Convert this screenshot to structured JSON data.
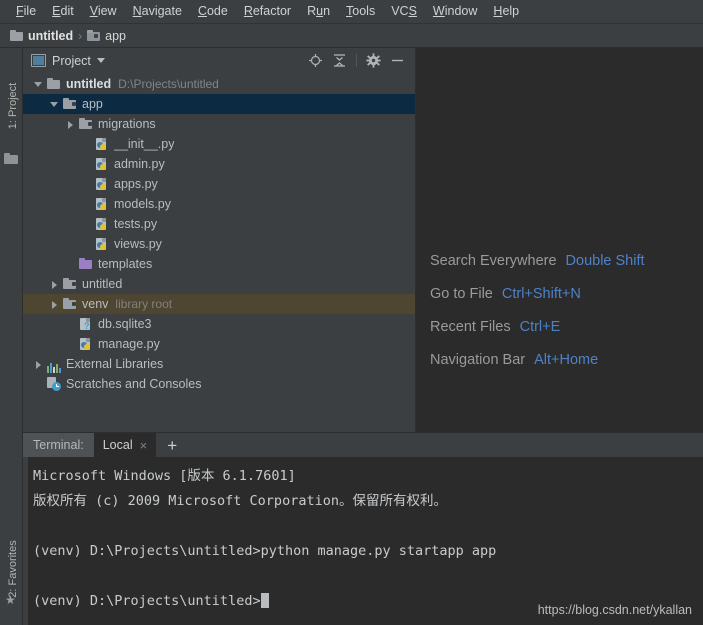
{
  "menubar": {
    "items": [
      {
        "label": "File",
        "accel": "F"
      },
      {
        "label": "Edit",
        "accel": "E"
      },
      {
        "label": "View",
        "accel": "V"
      },
      {
        "label": "Navigate",
        "accel": "N"
      },
      {
        "label": "Code",
        "accel": "C"
      },
      {
        "label": "Refactor",
        "accel": "R"
      },
      {
        "label": "Run",
        "accel": "u"
      },
      {
        "label": "Tools",
        "accel": "T"
      },
      {
        "label": "VCS",
        "accel": "S"
      },
      {
        "label": "Window",
        "accel": "W"
      },
      {
        "label": "Help",
        "accel": "H"
      }
    ]
  },
  "navbar": {
    "crumb1": "untitled",
    "separator": "›",
    "crumb2": "app"
  },
  "left_strip": {
    "project_tab": "1: Project",
    "favorites_tab": "2: Favorites"
  },
  "project_panel": {
    "title": "Project",
    "tools": {
      "locate": "locate-icon",
      "collapse": "collapse-all-icon",
      "settings": "gear-icon",
      "hide": "minimize-icon"
    },
    "tree": [
      {
        "label": "untitled",
        "hint": "D:\\Projects\\untitled",
        "icon": "folder",
        "arrow": "down",
        "indent": 0,
        "bold": true,
        "state": "normal"
      },
      {
        "label": "app",
        "hint": "",
        "icon": "folder-module",
        "arrow": "down",
        "indent": 1,
        "bold": false,
        "state": "selected"
      },
      {
        "label": "migrations",
        "hint": "",
        "icon": "folder-module",
        "arrow": "right",
        "indent": 2,
        "bold": false,
        "state": "normal"
      },
      {
        "label": "__init__.py",
        "hint": "",
        "icon": "python",
        "arrow": "none",
        "indent": 3,
        "bold": false,
        "state": "normal"
      },
      {
        "label": "admin.py",
        "hint": "",
        "icon": "python",
        "arrow": "none",
        "indent": 3,
        "bold": false,
        "state": "normal"
      },
      {
        "label": "apps.py",
        "hint": "",
        "icon": "python",
        "arrow": "none",
        "indent": 3,
        "bold": false,
        "state": "normal"
      },
      {
        "label": "models.py",
        "hint": "",
        "icon": "python",
        "arrow": "none",
        "indent": 3,
        "bold": false,
        "state": "normal"
      },
      {
        "label": "tests.py",
        "hint": "",
        "icon": "python",
        "arrow": "none",
        "indent": 3,
        "bold": false,
        "state": "normal"
      },
      {
        "label": "views.py",
        "hint": "",
        "icon": "python",
        "arrow": "none",
        "indent": 3,
        "bold": false,
        "state": "normal"
      },
      {
        "label": "templates",
        "hint": "",
        "icon": "folder-template",
        "arrow": "none",
        "indent": 2,
        "bold": false,
        "state": "normal"
      },
      {
        "label": "untitled",
        "hint": "",
        "icon": "folder-module",
        "arrow": "right",
        "indent": 1,
        "bold": false,
        "state": "normal"
      },
      {
        "label": "venv",
        "hint": "library root",
        "icon": "folder-module",
        "arrow": "right",
        "indent": 1,
        "bold": false,
        "state": "hover"
      },
      {
        "label": "db.sqlite3",
        "hint": "",
        "icon": "database",
        "arrow": "none",
        "indent": 2,
        "bold": false,
        "state": "normal"
      },
      {
        "label": "manage.py",
        "hint": "",
        "icon": "python",
        "arrow": "none",
        "indent": 2,
        "bold": false,
        "state": "normal"
      },
      {
        "label": "External Libraries",
        "hint": "",
        "icon": "library",
        "arrow": "right",
        "indent": 0,
        "bold": false,
        "state": "normal"
      },
      {
        "label": "Scratches and Consoles",
        "hint": "",
        "icon": "scratches",
        "arrow": "none",
        "indent": 0,
        "bold": false,
        "state": "normal"
      }
    ]
  },
  "editor": {
    "shortcuts": [
      {
        "action": "Search Everywhere",
        "key": "Double Shift"
      },
      {
        "action": "Go to File",
        "key": "Ctrl+Shift+N"
      },
      {
        "action": "Recent Files",
        "key": "Ctrl+E"
      },
      {
        "action": "Navigation Bar",
        "key": "Alt+Home"
      }
    ]
  },
  "terminal": {
    "label": "Terminal:",
    "tab_name": "Local",
    "close_icon": "×",
    "add_icon": "+",
    "lines": [
      "Microsoft Windows [版本 6.1.7601]",
      "版权所有 (c) 2009 Microsoft Corporation。保留所有权利。",
      "",
      "(venv) D:\\Projects\\untitled>python manage.py startapp app",
      "",
      "(venv) D:\\Projects\\untitled>"
    ],
    "prompt_last": "(venv) D:\\Projects\\untitled>"
  },
  "watermark": "https://blog.csdn.net/ykallan",
  "colors": {
    "panel_bg": "#3c3f41",
    "editor_bg": "#2b2b2b",
    "selection_blue": "#0d2a43",
    "hover_olive": "#4e4630",
    "shortcut_key": "#4e82c8",
    "text": "#a9b7c6"
  }
}
